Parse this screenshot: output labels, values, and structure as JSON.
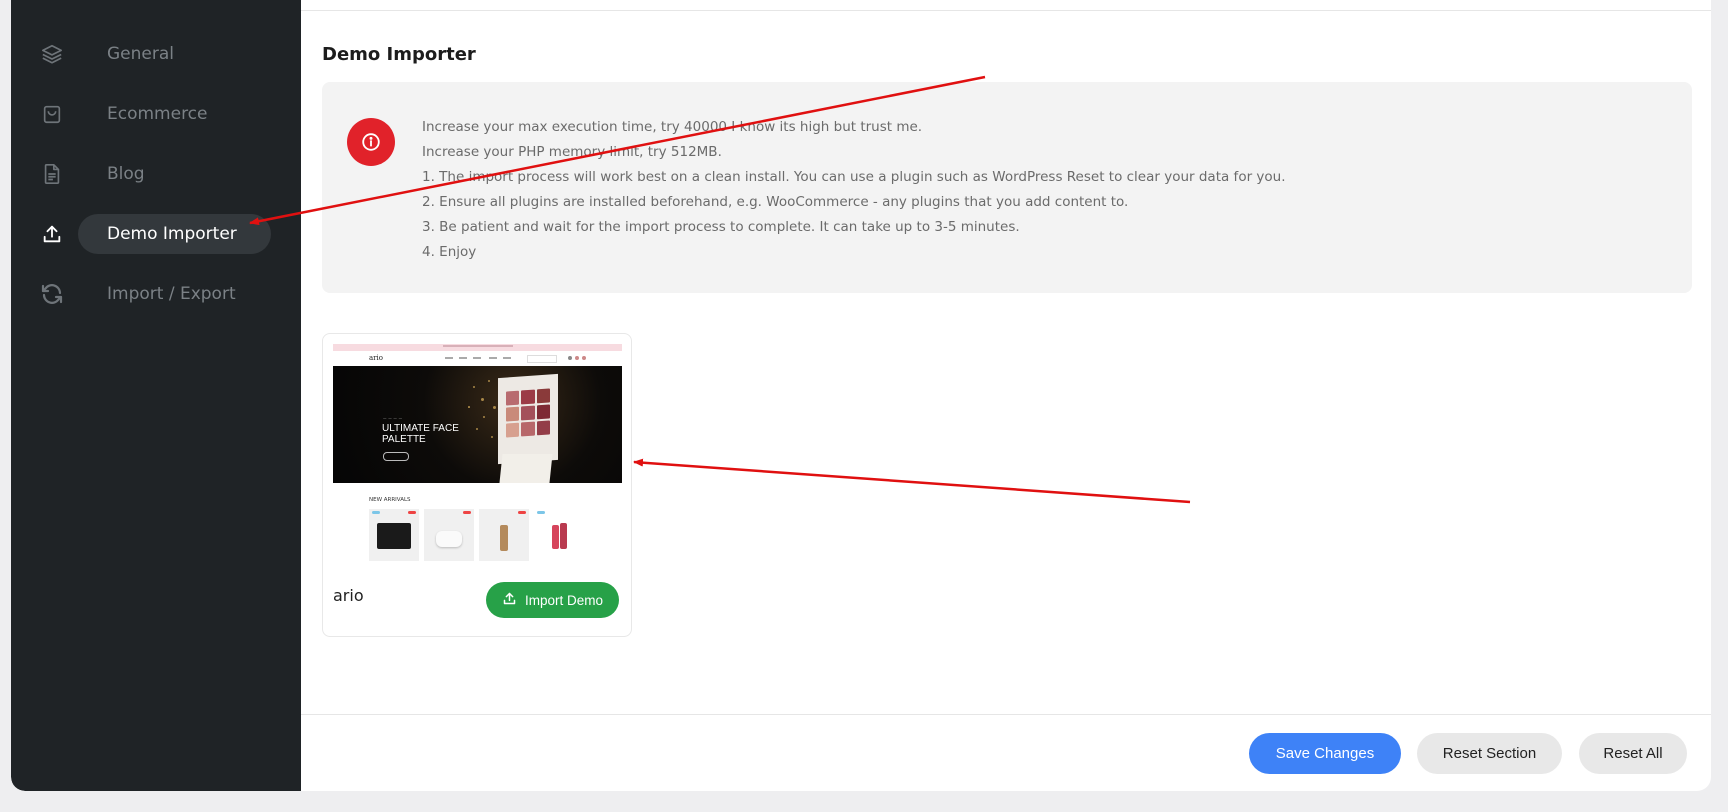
{
  "sidebar": {
    "items": [
      {
        "label": "General",
        "icon": "layers-icon",
        "active": false
      },
      {
        "label": "Ecommerce",
        "icon": "shopping-bag-icon",
        "active": false
      },
      {
        "label": "Blog",
        "icon": "document-icon",
        "active": false
      },
      {
        "label": "Demo Importer",
        "icon": "upload-icon",
        "active": true
      },
      {
        "label": "Import / Export",
        "icon": "refresh-icon",
        "active": false
      }
    ]
  },
  "main": {
    "title": "Demo Importer",
    "notice": {
      "icon": "info-icon",
      "lines": [
        "Increase your max execution time, try 40000 I know its high but trust me.",
        "Increase your PHP memory limit, try 512MB.",
        "1. The import process will work best on a clean install. You can use a plugin such as WordPress Reset to clear your data for you.",
        "2. Ensure all plugins are installed beforehand, e.g. WooCommerce - any plugins that you add content to.",
        "3. Be patient and wait for the import process to complete. It can take up to 3-5 minutes.",
        "4. Enjoy"
      ]
    },
    "demos": [
      {
        "name": "ario",
        "button_label": "Import Demo",
        "preview": {
          "brand": "ario",
          "hero_title": "ULTIMATE FACE PALETTE",
          "section_title": "NEW ARRIVALS"
        }
      }
    ]
  },
  "footer": {
    "save_label": "Save Changes",
    "reset_section_label": "Reset Section",
    "reset_all_label": "Reset All"
  },
  "colors": {
    "sidebar_bg": "#1f2326",
    "accent_blue": "#3e82f7",
    "import_green": "#27a148",
    "notice_red": "#e1222a",
    "annotation_arrow": "#e01010"
  }
}
